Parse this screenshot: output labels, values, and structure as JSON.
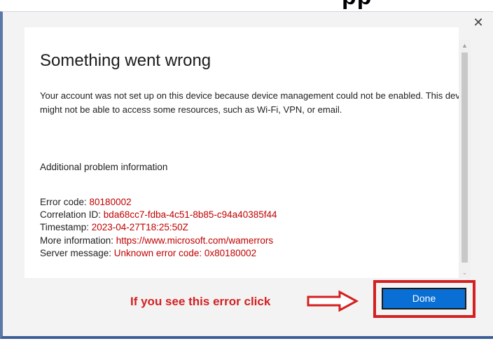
{
  "top_fragment": "pp",
  "dialog": {
    "close_glyph": "✕",
    "title": "Something went wrong",
    "body": "Your account was not set up on this device because device management could not be enabled. This device might not be able to access some resources, such as Wi-Fi, VPN, or email.",
    "section_heading": "Additional problem information",
    "details": {
      "error_code_label": "Error code: ",
      "error_code_value": "80180002",
      "correlation_label": "Correlation ID: ",
      "correlation_value": "bda68cc7-fdba-4c51-8b85-c94a40385f44",
      "timestamp_label": "Timestamp: ",
      "timestamp_value": "2023-04-27T18:25:50Z",
      "more_info_label": "More information: ",
      "more_info_value": "https://www.microsoft.com/wamerrors",
      "server_label": "Server message: ",
      "server_value": "Unknown error code: 0x80180002"
    },
    "done_label": "Done"
  },
  "annotation": {
    "text": "If you see this error click",
    "color": "#d32020"
  },
  "icons": [
    "close-icon",
    "scroll-up-icon",
    "scroll-down-icon",
    "right-arrow-icon"
  ]
}
